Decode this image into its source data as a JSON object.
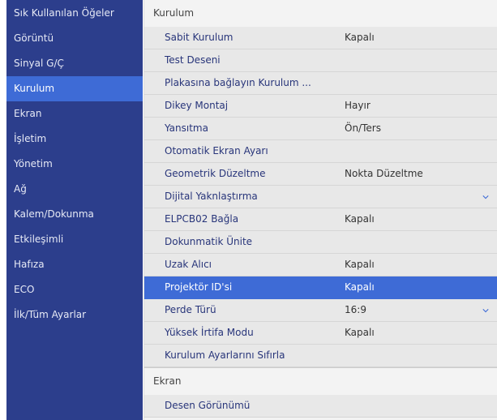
{
  "sidebar": {
    "items": [
      {
        "label": "Sık Kullanılan Öğeler"
      },
      {
        "label": "Görüntü"
      },
      {
        "label": "Sinyal G/Ç"
      },
      {
        "label": "Kurulum"
      },
      {
        "label": "Ekran"
      },
      {
        "label": "İşletim"
      },
      {
        "label": "Yönetim"
      },
      {
        "label": "Ağ"
      },
      {
        "label": "Kalem/Dokunma"
      },
      {
        "label": "Etkileşimli"
      },
      {
        "label": "Hafıza"
      },
      {
        "label": "ECO"
      },
      {
        "label": "İlk/Tüm Ayarlar"
      }
    ],
    "active": "Kurulum"
  },
  "main": {
    "section_title": "Kurulum",
    "rows": [
      {
        "label": "Sabit Kurulum",
        "value": "Kapalı"
      },
      {
        "label": "Test Deseni",
        "value": ""
      },
      {
        "label": "Plakasına bağlayın Kurulum ...",
        "value": ""
      },
      {
        "label": "Dikey Montaj",
        "value": "Hayır"
      },
      {
        "label": "Yansıtma",
        "value": "Ön/Ters"
      },
      {
        "label": "Otomatik Ekran Ayarı",
        "value": ""
      },
      {
        "label": "Geometrik Düzeltme",
        "value": "Nokta Düzeltme"
      },
      {
        "label": "Dijital Yaknlaştırma",
        "value": ""
      },
      {
        "label": "ELPCB02 Bağla",
        "value": "Kapalı"
      },
      {
        "label": "Dokunmatik Ünite",
        "value": ""
      },
      {
        "label": "Uzak Alıcı",
        "value": "Kapalı"
      },
      {
        "label": "Projektör ID'si",
        "value": "Kapalı"
      },
      {
        "label": "Perde Türü",
        "value": "16:9"
      },
      {
        "label": "Yüksek İrtifa Modu",
        "value": "Kapalı"
      },
      {
        "label": "Kurulum Ayarlarını Sıfırla",
        "value": ""
      }
    ],
    "active_row": "Projektör ID'si",
    "next_section_title": "Ekran",
    "next_rows": [
      {
        "label": "Desen Görünümü",
        "value": ""
      }
    ]
  },
  "colors": {
    "sidebar_bg": "#2c3e8c",
    "accent": "#3e6bd6",
    "row_bg": "#e8e8e8",
    "label_text": "#28357a"
  }
}
